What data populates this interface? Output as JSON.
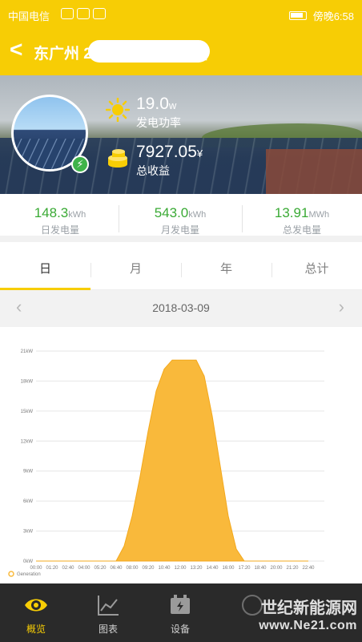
{
  "status_bar": {
    "carrier": "中国电信",
    "time": "傍晚6:58"
  },
  "header": {
    "back_label": "<",
    "title": "东广州                              20.16KW商用电站"
  },
  "hero": {
    "power": {
      "value": "19.0",
      "unit": "w",
      "label": "发电功率",
      "icon": "sun-icon"
    },
    "income": {
      "value": "7927.05",
      "unit": "¥",
      "label": "总收益",
      "icon": "coins-icon"
    }
  },
  "kpis": [
    {
      "value": "148.3",
      "unit": "kWh",
      "label": "日发电量"
    },
    {
      "value": "543.0",
      "unit": "kWh",
      "label": "月发电量"
    },
    {
      "value": "13.91",
      "unit": "MWh",
      "label": "总发电量"
    }
  ],
  "tabs": [
    "日",
    "月",
    "年",
    "总计"
  ],
  "active_tab": "日",
  "date": "2018-03-09",
  "colors": {
    "accent": "#f7cd05",
    "green": "#3aaa35",
    "area": "#f9b93b",
    "nav_bg": "#2a2a2a"
  },
  "chart_data": {
    "type": "area",
    "x": [
      "00:00",
      "01:20",
      "02:40",
      "04:00",
      "05:20",
      "06:40",
      "08:00",
      "09:20",
      "10:40",
      "12:00",
      "13:20",
      "14:40",
      "16:00",
      "17:20",
      "18:40",
      "20:00",
      "21:20",
      "22:40"
    ],
    "yticks": [
      "0kW",
      "3kW",
      "6kW",
      "9kW",
      "12kW",
      "15kW",
      "18kW",
      "21kW"
    ],
    "ylim": [
      0,
      21
    ],
    "series": [
      {
        "name": "Generation",
        "points": [
          [
            "00:00",
            0
          ],
          [
            "01:20",
            0
          ],
          [
            "02:40",
            0
          ],
          [
            "04:00",
            0
          ],
          [
            "05:20",
            0
          ],
          [
            "06:40",
            0
          ],
          [
            "07:20",
            1.5
          ],
          [
            "08:00",
            4.5
          ],
          [
            "08:40",
            8.5
          ],
          [
            "09:20",
            13
          ],
          [
            "10:00",
            17
          ],
          [
            "10:40",
            19.2
          ],
          [
            "11:20",
            20.1
          ],
          [
            "12:00",
            20.1
          ],
          [
            "12:40",
            20.1
          ],
          [
            "13:20",
            20.1
          ],
          [
            "14:00",
            18.5
          ],
          [
            "14:40",
            14.5
          ],
          [
            "15:20",
            9.5
          ],
          [
            "16:00",
            4.5
          ],
          [
            "16:40",
            1.2
          ],
          [
            "17:20",
            0
          ],
          [
            "18:40",
            0
          ],
          [
            "20:00",
            0
          ],
          [
            "21:20",
            0
          ],
          [
            "22:40",
            0
          ]
        ]
      }
    ],
    "legend": "bottom-left"
  },
  "bottom_nav": [
    {
      "label": "概览",
      "icon": "eye-icon",
      "active": true
    },
    {
      "label": "图表",
      "icon": "chart-icon",
      "active": false
    },
    {
      "label": "设备",
      "icon": "device-icon",
      "active": false
    },
    {
      "label": "",
      "icon": "more-icon",
      "active": false
    }
  ],
  "watermark": {
    "line1": "世纪新能源网",
    "line2": "www.Ne21.com"
  }
}
